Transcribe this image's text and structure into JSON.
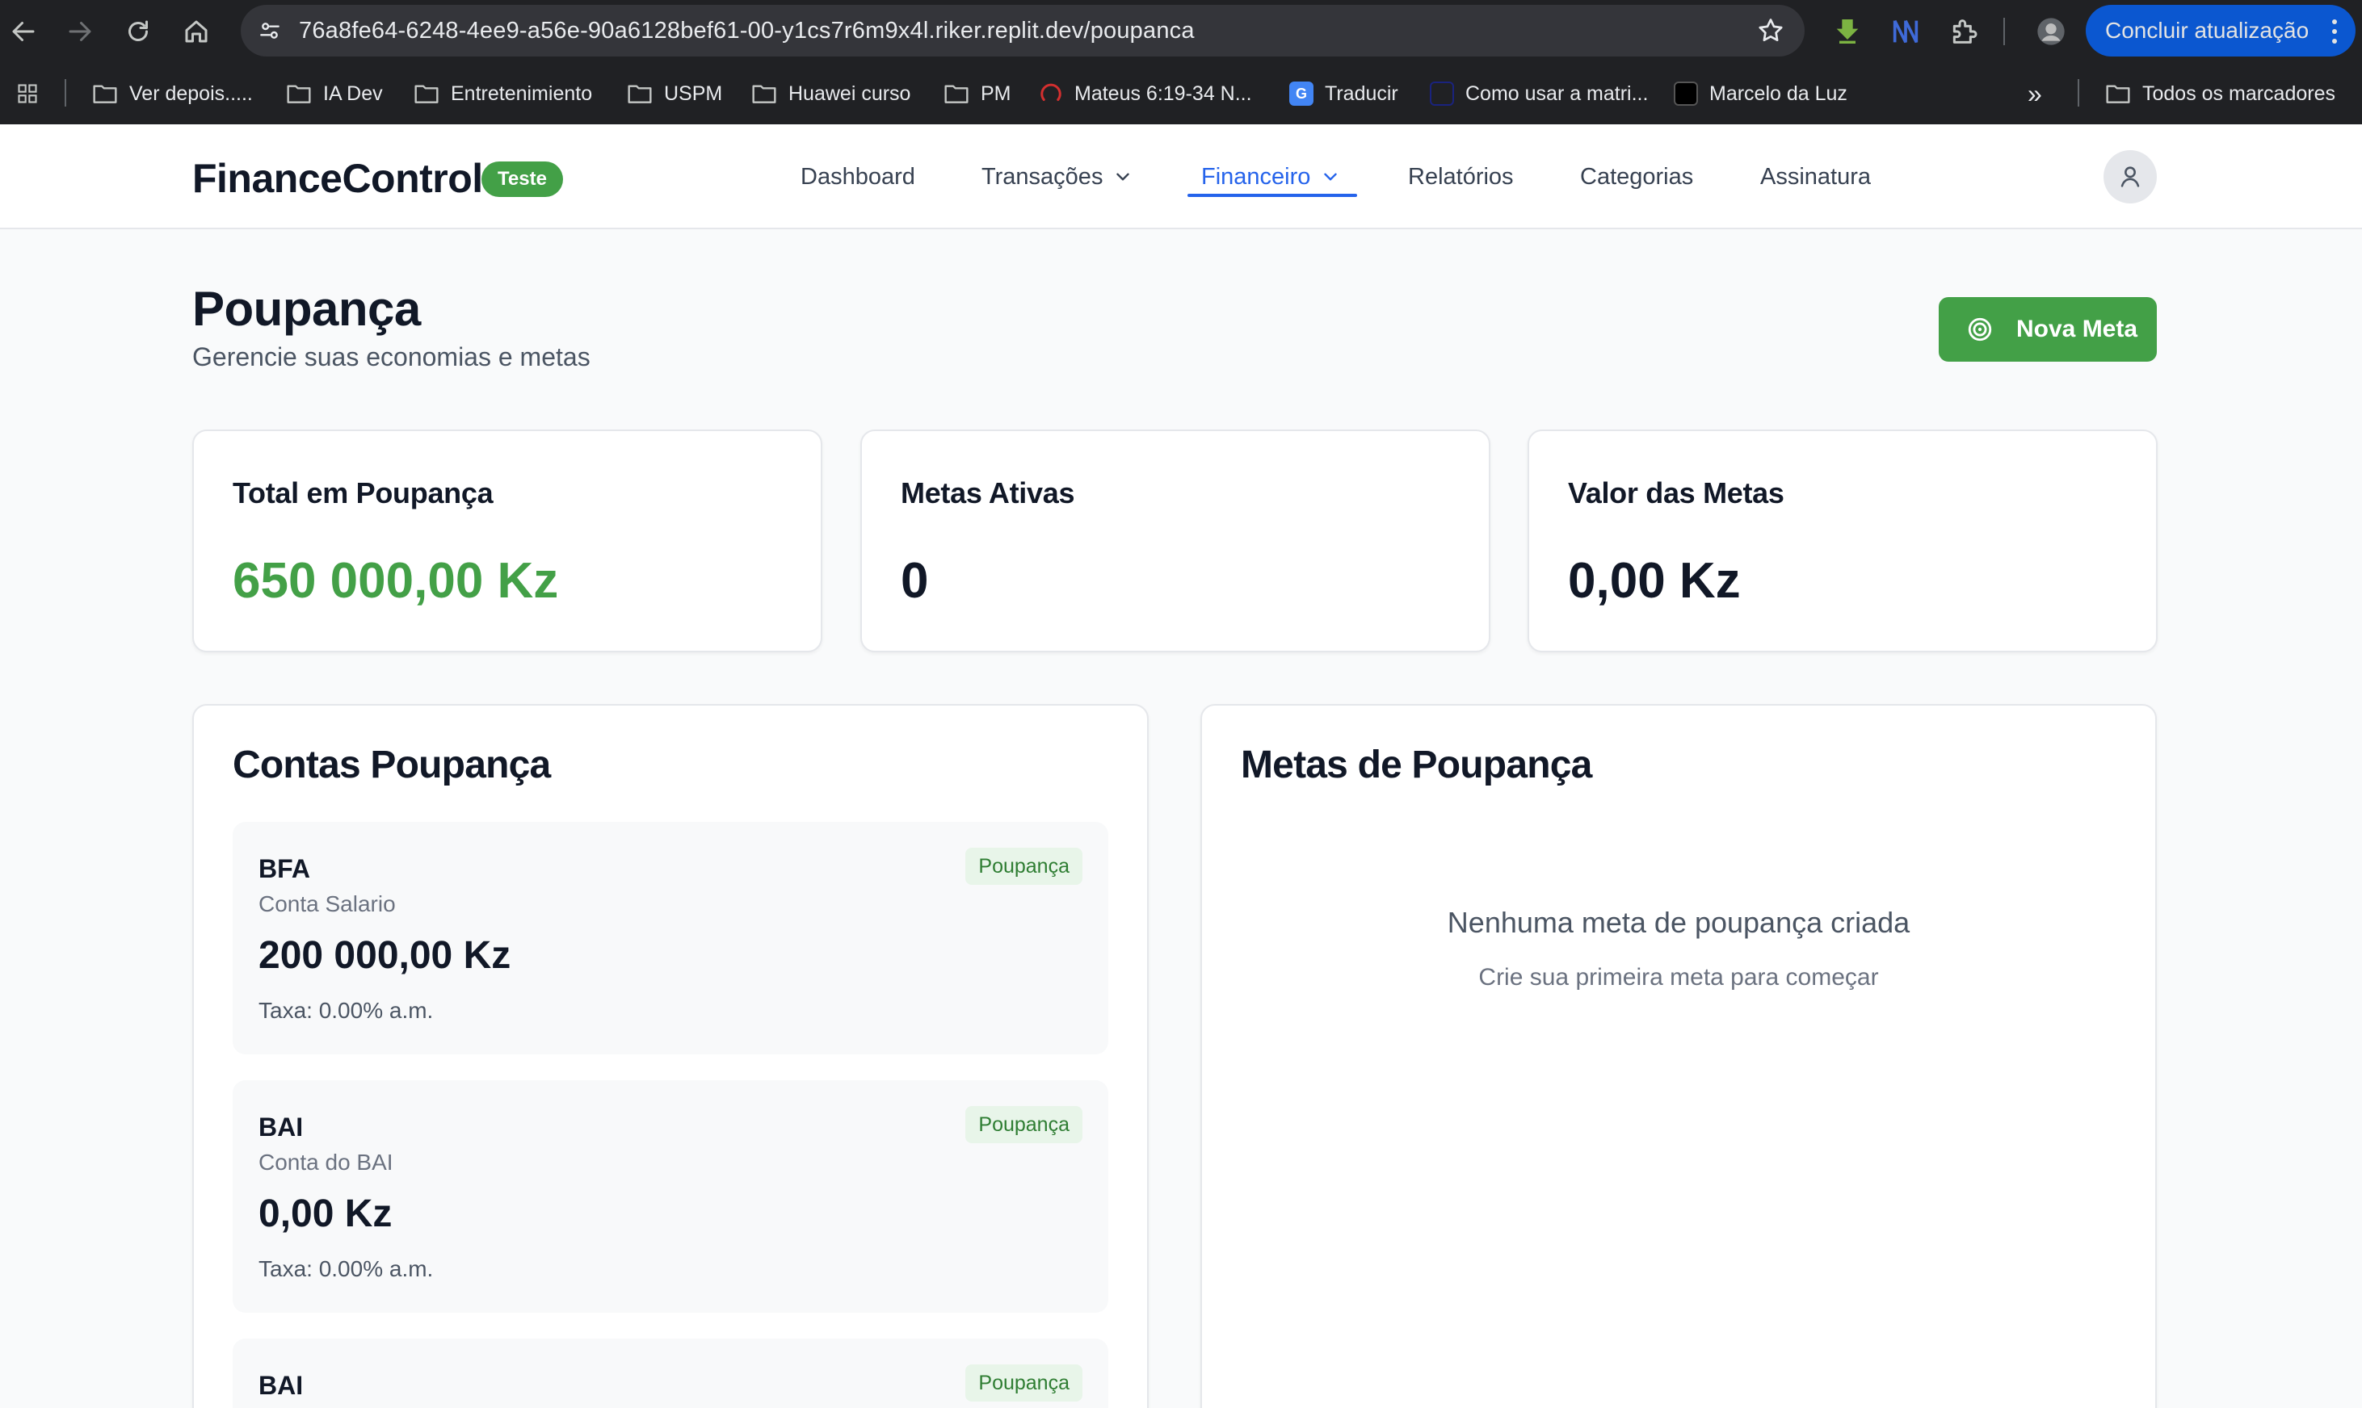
{
  "browser": {
    "url": "76a8fe64-6248-4ee9-a56e-90a6128bef61-00-y1cs7r6m9x4l.riker.replit.dev/poupanca",
    "update_label": "Concluir atualização",
    "bookmarks": [
      {
        "label": "Ver depois.....",
        "icon": "folder-icon"
      },
      {
        "label": "IA Dev",
        "icon": "folder-icon"
      },
      {
        "label": "Entretenimiento",
        "icon": "folder-icon"
      },
      {
        "label": "USPM",
        "icon": "folder-icon"
      },
      {
        "label": "Huawei curso",
        "icon": "folder-icon"
      },
      {
        "label": "PM",
        "icon": "folder-icon"
      },
      {
        "label": "Mateus 6:19-34 N...",
        "icon": "podcast-icon"
      },
      {
        "label": "Traducir",
        "icon": "google-translate-icon"
      },
      {
        "label": "Como usar a matri...",
        "icon": "site-icon"
      },
      {
        "label": "Marcelo da Luz",
        "icon": "site-icon"
      }
    ],
    "all_bookmarks": "Todos os marcadores"
  },
  "app": {
    "brand": "FinanceControl",
    "badge": "Teste",
    "nav": {
      "dashboard": "Dashboard",
      "transacoes": "Transações",
      "financeiro": "Financeiro",
      "relatorios": "Relatórios",
      "categorias": "Categorias",
      "assinatura": "Assinatura"
    },
    "active_nav": "Financeiro",
    "accent_color": "#43a047",
    "link_color": "#2563eb"
  },
  "page": {
    "title": "Poupança",
    "subtitle": "Gerencie suas economias e metas",
    "new_goal_button": "Nova Meta"
  },
  "stats": {
    "total": {
      "label": "Total em Poupança",
      "value": "650 000,00 Kz"
    },
    "active_goals": {
      "label": "Metas Ativas",
      "value": "0"
    },
    "goals_value": {
      "label": "Valor das Metas",
      "value": "0,00 Kz"
    }
  },
  "accounts_panel": {
    "title": "Contas Poupança",
    "accounts": [
      {
        "bank": "BFA",
        "description": "Conta Salario",
        "amount": "200 000,00 Kz",
        "rate": "Taxa: 0.00% a.m.",
        "type": "Poupança"
      },
      {
        "bank": "BAI",
        "description": "Conta do BAI",
        "amount": "0,00 Kz",
        "rate": "Taxa: 0.00% a.m.",
        "type": "Poupança"
      },
      {
        "bank": "BAI",
        "type": "Poupança"
      }
    ]
  },
  "goals_panel": {
    "title": "Metas de Poupança",
    "empty_title": "Nenhuma meta de poupança criada",
    "empty_subtitle": "Crie sua primeira meta para começar"
  }
}
